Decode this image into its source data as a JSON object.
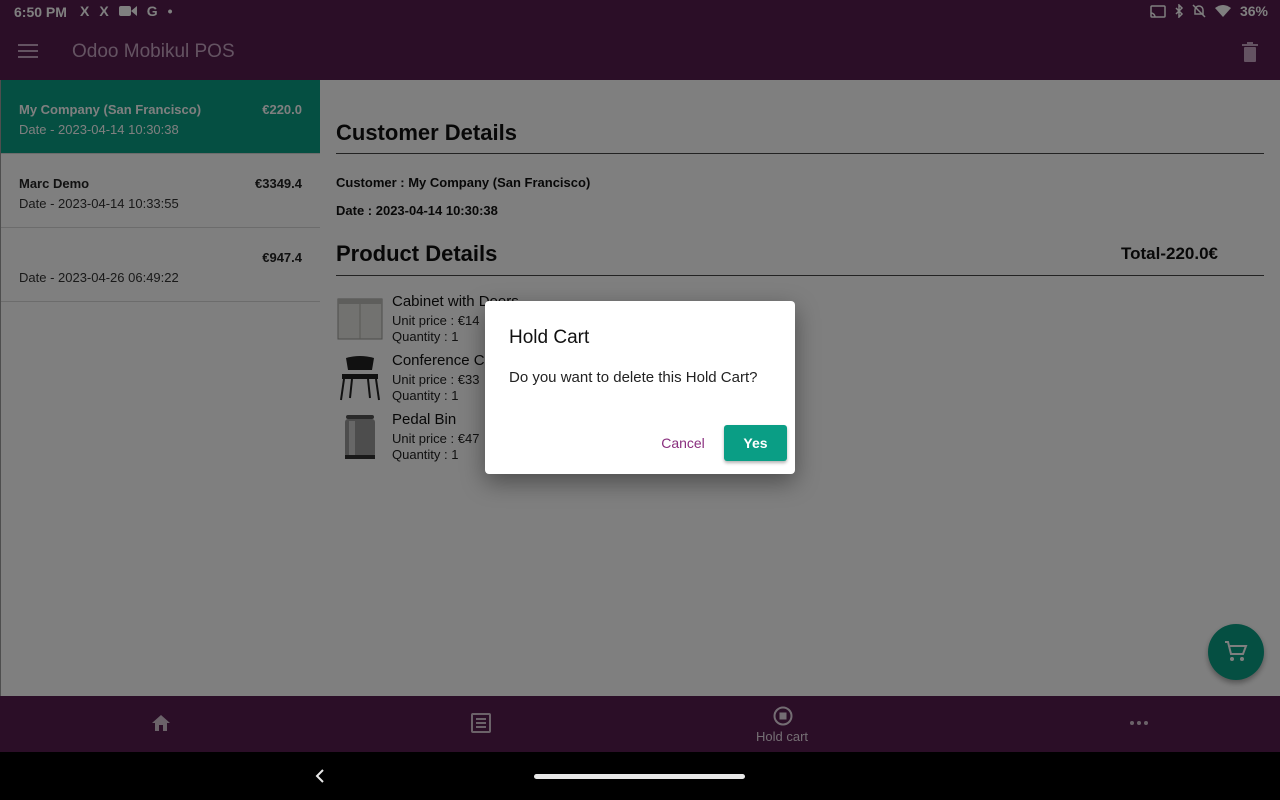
{
  "status_bar": {
    "time": "6:50 PM",
    "battery": "36%",
    "left_glyphs": [
      "X",
      "X",
      "G",
      "•"
    ]
  },
  "app_bar": {
    "title": "Odoo Mobikul POS"
  },
  "hold_carts": [
    {
      "name": "My Company (San Francisco)",
      "amount": "€220.0",
      "date": "Date - 2023-04-14 10:30:38",
      "selected": true
    },
    {
      "name": "Marc Demo",
      "amount": "€3349.4",
      "date": "Date - 2023-04-14 10:33:55",
      "selected": false
    },
    {
      "name": "",
      "amount": "€947.4",
      "date": "Date - 2023-04-26 06:49:22",
      "selected": false
    }
  ],
  "customer_details": {
    "title": "Customer Details",
    "customer": "Customer : My Company (San Francisco)",
    "date": "Date : 2023-04-14 10:30:38"
  },
  "product_details": {
    "title": "Product Details",
    "total": "Total-220.0€",
    "products": [
      {
        "name": "Cabinet with Doors",
        "unit_price": "Unit price : €14",
        "quantity": "Quantity : 1"
      },
      {
        "name": "Conference C",
        "unit_price": "Unit price : €33",
        "quantity": "Quantity : 1"
      },
      {
        "name": "Pedal Bin",
        "unit_price": "Unit price : €47",
        "quantity": "Quantity : 1"
      }
    ]
  },
  "bottom_nav": {
    "items": [
      {
        "icon": "home-icon",
        "label": ""
      },
      {
        "icon": "list-icon",
        "label": ""
      },
      {
        "icon": "hold-cart-icon",
        "label": "Hold cart"
      },
      {
        "icon": "more-icon",
        "label": ""
      }
    ]
  },
  "dialog": {
    "title": "Hold Cart",
    "message": "Do you want to delete this Hold Cart?",
    "cancel_label": "Cancel",
    "confirm_label": "Yes"
  },
  "colors": {
    "primary": "#561d4f",
    "accent": "#0a9e85",
    "cancel_text": "#8a2f7e"
  }
}
